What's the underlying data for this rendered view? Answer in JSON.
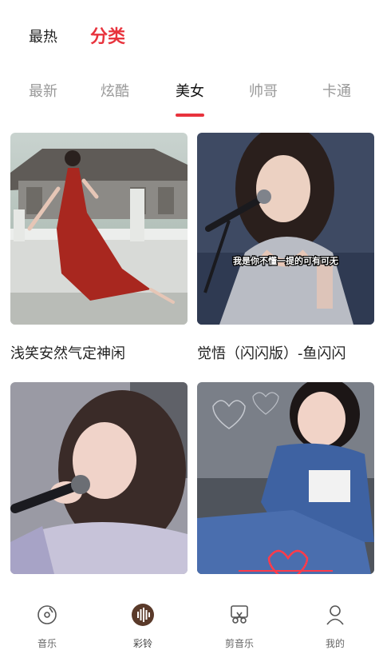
{
  "top_tabs": [
    "最热",
    "分类"
  ],
  "active_top_tab": "分类",
  "category_tabs": [
    "最新",
    "炫酷",
    "美女",
    "帅哥",
    "卡通"
  ],
  "active_category": "美女",
  "cards": [
    {
      "title": "浅笑安然气定神闲",
      "image": "woman-red-dress-dancing-photo"
    },
    {
      "title": "觉悟（闪闪版）-鱼闪闪",
      "image": "woman-singing-microphone-photo",
      "caption": "我是你不懂一提的可有可无"
    },
    {
      "title": "",
      "image": "woman-singing-microphone-closeup-photo"
    },
    {
      "title": "",
      "image": "woman-denim-sitting-hearts-photo"
    }
  ],
  "bottom_nav": [
    {
      "label": "音乐",
      "icon": "music-disc-icon"
    },
    {
      "label": "彩铃",
      "icon": "soundwave-icon"
    },
    {
      "label": "剪音乐",
      "icon": "scissors-icon"
    },
    {
      "label": "我的",
      "icon": "user-icon"
    }
  ],
  "active_nav": "彩铃",
  "colors": {
    "accent": "#e8333d",
    "nav_active": "#5a3a2a"
  }
}
